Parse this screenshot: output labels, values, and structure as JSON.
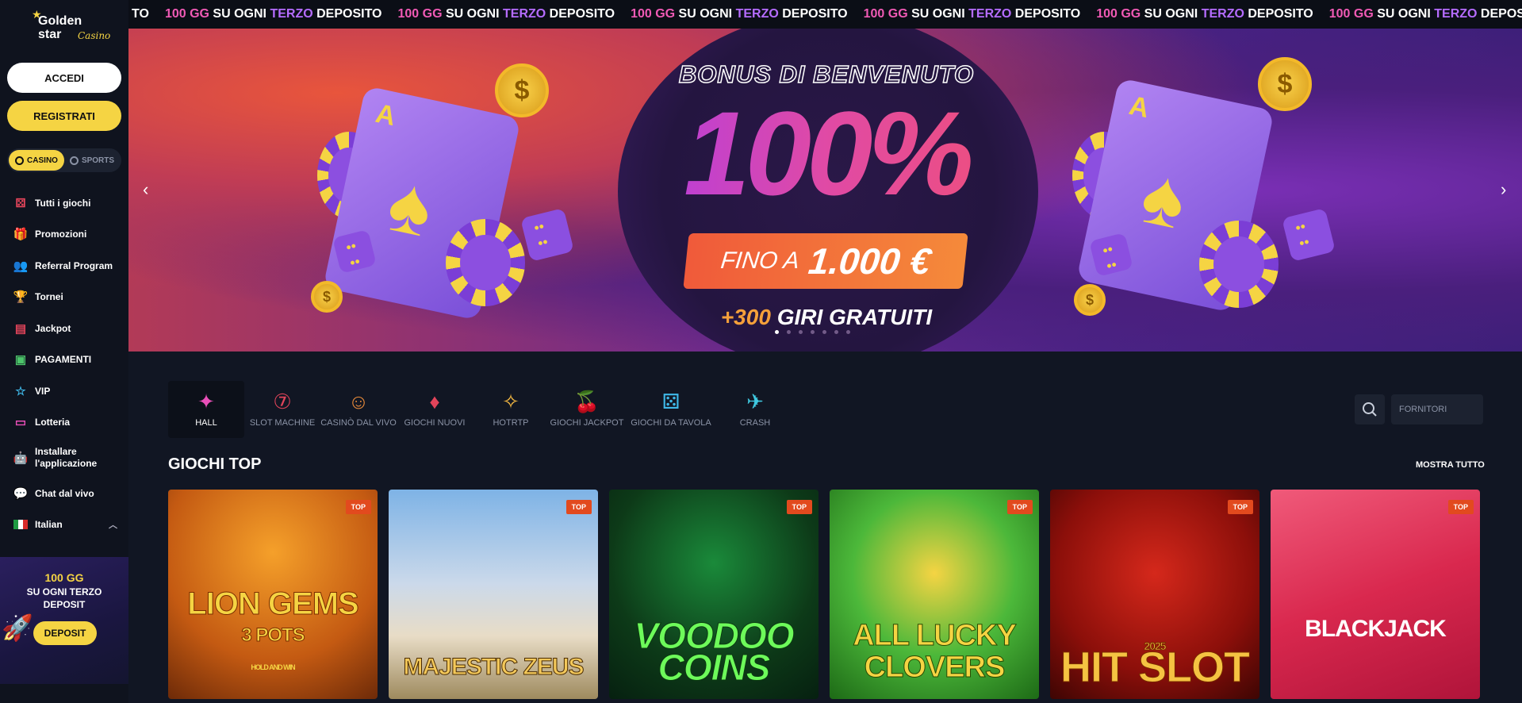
{
  "brand": {
    "name_line1": "Golden",
    "name_line2": "star",
    "name_script": "Casino"
  },
  "auth": {
    "login_label": "ACCEDI",
    "register_label": "REGISTRATI"
  },
  "mode_switch": {
    "casino_label": "CASINO",
    "sports_label": "SPORTS"
  },
  "sidebar": {
    "items": [
      {
        "label": "Tutti i giochi",
        "icon": "dice-icon"
      },
      {
        "label": "Promozioni",
        "icon": "gift-icon"
      },
      {
        "label": "Referral Program",
        "icon": "users-icon"
      },
      {
        "label": "Tornei",
        "icon": "trophy-icon"
      },
      {
        "label": "Jackpot",
        "icon": "jackpot-icon"
      },
      {
        "label": "PAGAMENTI",
        "icon": "cash-icon"
      },
      {
        "label": "VIP",
        "icon": "star-icon"
      },
      {
        "label": "Lotteria",
        "icon": "ticket-icon"
      },
      {
        "label": "Installare l'applicazione",
        "icon": "android-icon"
      },
      {
        "label": "Chat dal vivo",
        "icon": "chat-icon"
      },
      {
        "label": "Italian",
        "icon": "flag-italy-icon"
      }
    ]
  },
  "promo_box": {
    "title": "100 GG",
    "subtitle": "SU OGNI TERZO DEPOSIT",
    "button_label": "DEPOSIT"
  },
  "ticker": {
    "partial": "TO",
    "amount": "100 GG",
    "middle": "SU OGNI",
    "highlight": "TERZO",
    "end": "DEPOSITO"
  },
  "banner": {
    "heading": "BONUS DI BENVENUTO",
    "percent": "100%",
    "fino_a": "FINO A",
    "amount": "1.000 €",
    "spins_num": "+300",
    "spins_text": "GIRI GRATUITI"
  },
  "categories": [
    {
      "label": "HALL",
      "icon": "sparkles-icon",
      "color": "#e94fb8"
    },
    {
      "label": "SLOT MACHINE",
      "icon": "slot-icon",
      "color": "#e2445a"
    },
    {
      "label": "CASINÒ DAL VIVO",
      "icon": "dealer-icon",
      "color": "#e88a3a"
    },
    {
      "label": "GIOCHI NUOVI",
      "icon": "cards-icon",
      "color": "#e2445a"
    },
    {
      "label": "HOTRTP",
      "icon": "sparkles-icon",
      "color": "#f5b942"
    },
    {
      "label": "GIOCHI JACKPOT",
      "icon": "cherry-icon",
      "color": "#6bd24a"
    },
    {
      "label": "GIOCHI DA TAVOLA",
      "icon": "dice-icon",
      "color": "#3fb8e8"
    },
    {
      "label": "CRASH",
      "icon": "plane-icon",
      "color": "#3fc8e0"
    }
  ],
  "search": {
    "placeholder": "FORNITORI"
  },
  "section": {
    "title": "GIOCHI TOP",
    "show_all": "MOSTRA TUTTO"
  },
  "games": [
    {
      "name": "LION GEMS",
      "sub": "3 POTS",
      "sub2": "HOLD AND WIN",
      "badge": "TOP"
    },
    {
      "name": "MAJESTIC ZEUS",
      "badge": "TOP"
    },
    {
      "name": "VOODOO COINS",
      "badge": "TOP"
    },
    {
      "name": "ALL LUCKY CLOVERS",
      "badge": "TOP"
    },
    {
      "name": "HIT SLOT",
      "year": "2025",
      "badge": "TOP"
    },
    {
      "name": "BLACKJACK",
      "badge": "TOP"
    }
  ],
  "colors": {
    "accent_yellow": "#f5d443",
    "ticker_pink": "#f05ab5",
    "ticker_purple": "#b56cff",
    "badge_red": "#e24a1e"
  }
}
